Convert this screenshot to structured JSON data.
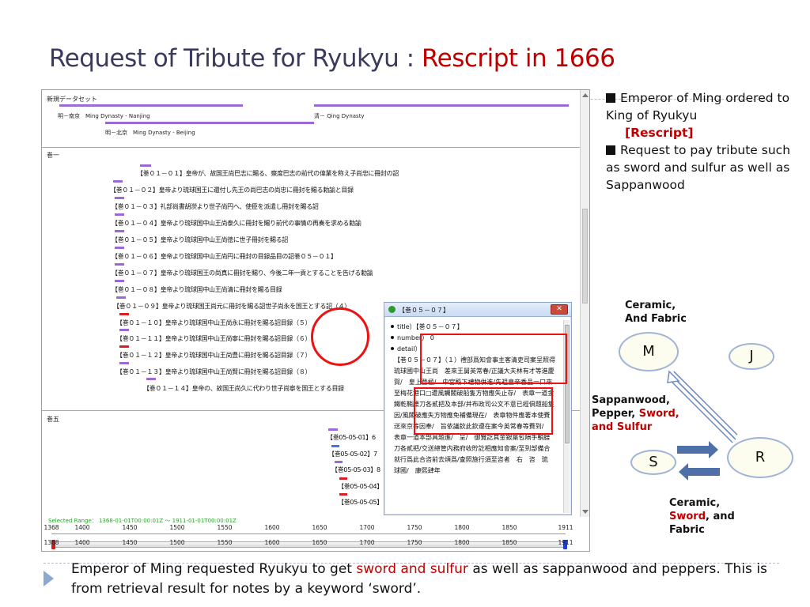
{
  "slide": {
    "title_main": "Request of Tribute for Ryukyu : ",
    "title_accent": "Rescript in 1666"
  },
  "app": {
    "set_title": "新規データセット",
    "dynasties": {
      "ming_nanjing": "明－南京　Ming Dynasty - Nanjing",
      "qing": "清－ Qing Dynasty",
      "ming_beijing": "明－北京　Ming Dynasty - Beijing"
    },
    "volume1_label": "巻一",
    "volume5_label": "巻五",
    "entries": [
      "【巻０１－０１】皇帝が、故国王尚巴志に賜る、察度巴志の前代の偉業を称え子尚忠に冊封の詔",
      "【巻０１－０２】皇帝より琉球国王に還付し先王の尚巴志の尚忠に冊封を賜る勅諭と目録",
      "【巻０１－０３】礼部尚書胡濙より世子尚円へ、使臣を派遣し冊封を賜る詔",
      "【巻０１－０４】皇帝より琉球国中山王尚泰久に冊封を賜り前代の事情の再奏を求める勅諭",
      "【巻０１－０５】皇帝より琉球国中山王尚徳に世子冊封を賜る詔",
      "【巻０１－０６】皇帝より琉球国中山王尚円に冊封の目録品目の詔巻０５－０１】",
      "【巻０１－０７】皇帝より琉球国王の尚真に冊封を賜り、今後二年一貢とすることを告げる勅諭",
      "【巻０１－０８】皇帝より琉球国中山王尚清に冊封を賜る目録",
      "【巻０１－０９】皇帝より琉球国王尚元に冊封を賜る詔世子尚永を国王とする詔（４）",
      "【巻０１－１０】皇帝より琉球国中山王尚永に冊封を賜る詔目録（５）",
      "【巻０１－１１】皇帝より琉球国中山王尚寧に冊封を賜る詔目録（６）",
      "【巻０１－１２】皇帝より琉球国中山王尚豊に冊封を賜る詔目録（７）",
      "【巻０１－１３】皇帝より琉球国中山王尚賢に冊封を賜る詔目録（８）",
      "【巻０１－１４】皇帝の、故国王尚久に代わり世子尚寧を国王とする目録"
    ],
    "vol5_entries": [
      "【巻05-05-01】6",
      "【巻05-05-02】7",
      "【巻05-05-03】8",
      "【巻05-05-04】",
      "【巻05-05-05】"
    ],
    "popup": {
      "window_title": "【巻０５－０７】",
      "close_label": "✕",
      "title_key": "title）",
      "title_value": "【巻０５－０７】",
      "number_key": "number）",
      "number_value": "0",
      "detail_key": "detail）",
      "detail_text": "【巻０５－０７】（１）禮部爲知會事主客清吏司案呈照得琉球國中山王尚　差來王舅英常春/正議大夫林有才等進慶賀/　皇上登極/　中宮殿下禮物併進/先祖皇帝香品一口來至梅花港口□遭風觸閣破船隻方物應失止存/　表章一道金鐵乾鞘腰刀各貳把及本部/并布政司公文不意已經俱題船隻因/風閣破應失方物應免補備現在/　表章物件應著本使賚送來京等因奉/　旨依議欽此欽遵在案今英常春等賚到/　表章一道本部具題進/　呈/　御覽訖其金銀葉包隔手鞘腰刀各貳把/交送總管内務府收貯訖相應知會案/至到部備合就行爲此合咨前去煩爲/査照施行須至咨者　右　咨　琉　球國/　康熙肆年"
    },
    "status_text": "Selected Range： 1368-01-01T00:00:01Z ～ 1911-01-01T00:00:01Z",
    "axis_ticks": [
      "1368",
      "1400",
      "1450",
      "1500",
      "1550",
      "1600",
      "1650",
      "1700",
      "1750",
      "1800",
      "1850",
      "1911"
    ]
  },
  "bullets": {
    "b1_line1": "Emperor of Ming ordered to King of Ryukyu",
    "b1_rescript": "[Rescript]",
    "b2": "Request to pay tribute such as sword and sulfur as well as Sappanwood"
  },
  "diagram": {
    "top_label_1": "Ceramic,",
    "top_label_2": "And Fabric",
    "mid_label_1": "Sappanwood,",
    "mid_label_2a": "Pepper, ",
    "mid_label_2b": "Sword,",
    "mid_label_3": "and Sulfur",
    "bot_label_1": "Ceramic,",
    "bot_label_2a": "Sword",
    "bot_label_2b": ", and",
    "bot_label_3": "Fabric",
    "node_m": "M",
    "node_j": "J",
    "node_s": "S",
    "node_r": "R"
  },
  "footer": {
    "part1": "Emperor of Ming requested Ryukyu to get ",
    "part2": "sword and sulfur",
    "part3": " as well as sappanwood and peppers.   This is from retrieval result for notes by a keyword ‘sword’."
  },
  "colors": {
    "accent_red": "#c00000",
    "title_color": "#3a3a5c",
    "timeline_bar": "#9b6ad6",
    "node_border": "#9fb4d6"
  }
}
